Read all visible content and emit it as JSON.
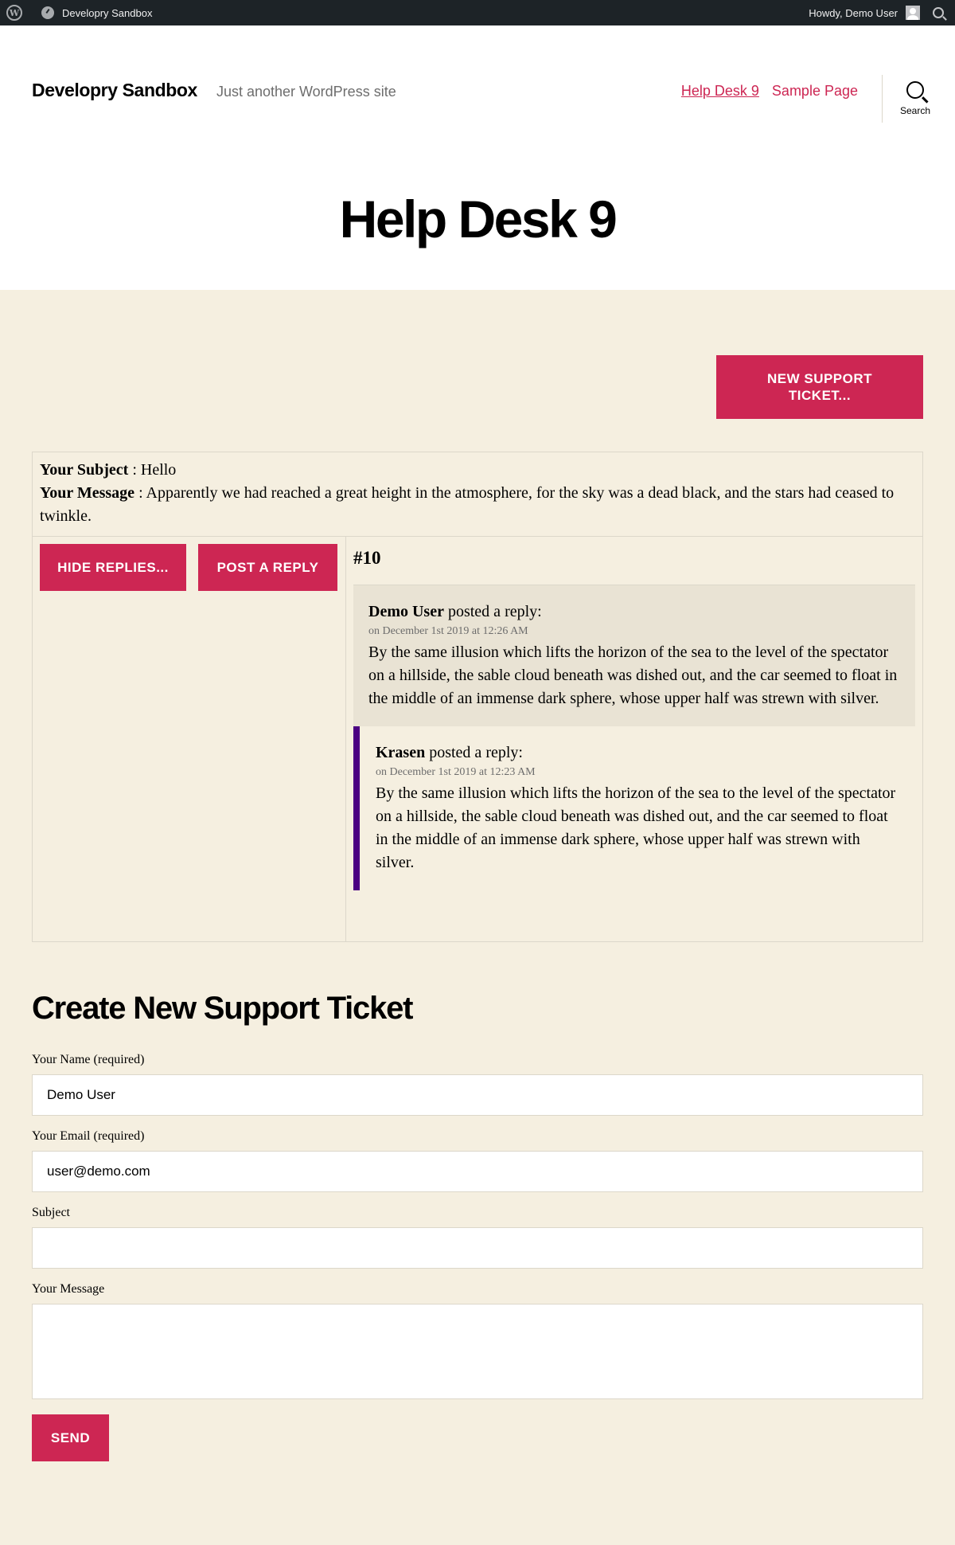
{
  "admin_bar": {
    "site_name": "Developry Sandbox",
    "greeting": "Howdy, Demo User"
  },
  "header": {
    "site_title": "Developry Sandbox",
    "site_description": "Just another WordPress site",
    "menu": [
      {
        "label": "Help Desk 9",
        "current": true
      },
      {
        "label": "Sample Page",
        "current": false
      }
    ],
    "search_label": "Search"
  },
  "page": {
    "title": "Help Desk 9"
  },
  "content": {
    "new_ticket_button": "NEW SUPPORT TICKET...",
    "ticket": {
      "subject_label": "Your Subject",
      "subject": "Hello",
      "message_label": "Your Message",
      "message": "Apparently we had reached a great height in the atmosphere, for the sky was a dead black, and the stars had ceased to twinkle.",
      "hide_replies_button": "HIDE REPLIES...",
      "post_reply_button": "POST A REPLY",
      "number": "#10",
      "replies": [
        {
          "author": "Demo User",
          "action": "posted a reply:",
          "date": "on December 1st 2019 at 12:26 AM",
          "text": "By the same illusion which lifts the horizon of the sea to the level of the spectator on a hillside, the sable cloud beneath was dished out, and the car seemed to float in the middle of an immense dark sphere, whose upper half was strewn with silver."
        },
        {
          "author": "Krasen",
          "action": "posted a reply:",
          "date": "on December 1st 2019 at 12:23 AM",
          "text": "By the same illusion which lifts the horizon of the sea to the level of the spectator on a hillside, the sable cloud beneath was dished out, and the car seemed to float in the middle of an immense dark sphere, whose upper half was strewn with silver."
        }
      ]
    },
    "form": {
      "title": "Create New Support Ticket",
      "name_label": "Your Name (required)",
      "name_value": "Demo User",
      "email_label": "Your Email (required)",
      "email_value": "user@demo.com",
      "subject_label": "Subject",
      "subject_value": "",
      "message_label": "Your Message",
      "message_value": "",
      "send_button": "SEND"
    }
  },
  "colors": {
    "accent": "#cd2653",
    "background": "#f5efe0",
    "admin_bar": "#1d2327",
    "reply_highlight": "#e9e3d4",
    "reply_border": "#4b0082"
  }
}
